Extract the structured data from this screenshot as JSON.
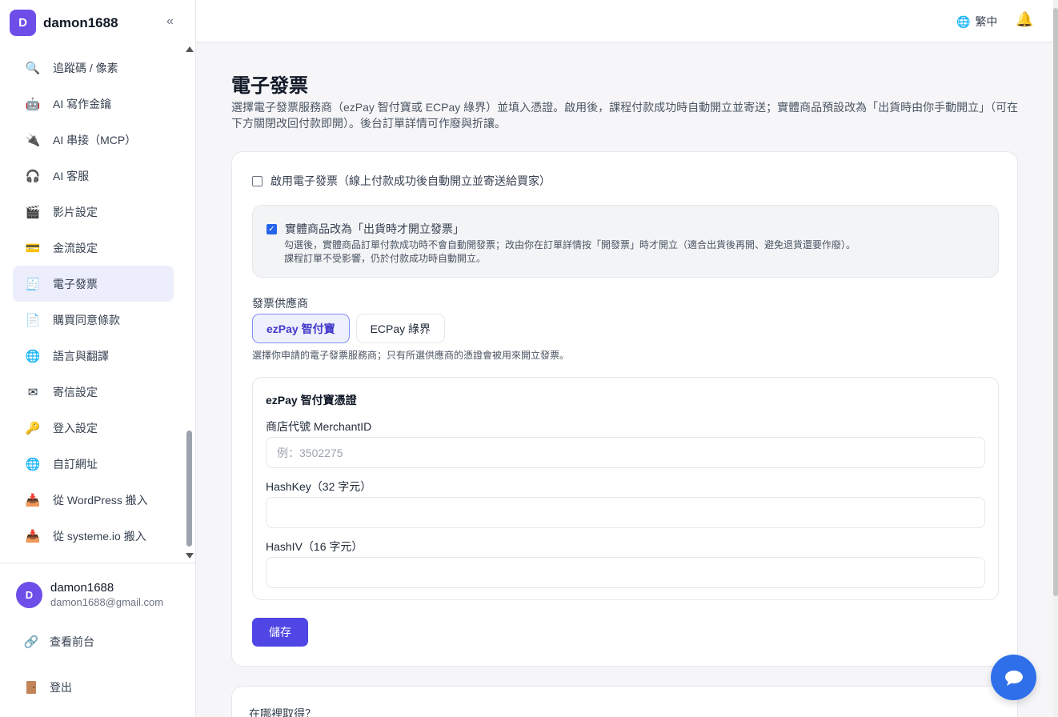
{
  "brand": {
    "initial": "D",
    "name": "damon1688",
    "collapse_icon": "«"
  },
  "sidebar": {
    "items": [
      {
        "label": "追蹤碼 / 像素",
        "icon": "🔍"
      },
      {
        "label": "AI 寫作金鑰",
        "icon": "🤖"
      },
      {
        "label": "AI 串接（MCP）",
        "icon": "🔌"
      },
      {
        "label": "AI 客服",
        "icon": "🎧"
      },
      {
        "label": "影片設定",
        "icon": "🎬"
      },
      {
        "label": "金流設定",
        "icon": "💳"
      },
      {
        "label": "電子發票",
        "icon": "🧾"
      },
      {
        "label": "購買同意條款",
        "icon": "📄"
      },
      {
        "label": "語言與翻譯",
        "icon": "🌐"
      },
      {
        "label": "寄信設定",
        "icon": "✉"
      },
      {
        "label": "登入設定",
        "icon": "🔑"
      },
      {
        "label": "自訂網址",
        "icon": "🌐"
      },
      {
        "label": "從 WordPress 搬入",
        "icon": "📥"
      },
      {
        "label": "從 systeme.io 搬入",
        "icon": "📥"
      }
    ],
    "active_index": 6
  },
  "user": {
    "initial": "D",
    "name": "damon1688",
    "email": "damon1688@gmail.com"
  },
  "side_links": {
    "view_frontend": "查看前台",
    "logout": "登出"
  },
  "topbar": {
    "lang_label": "繁中"
  },
  "main": {
    "title": "電子發票",
    "description": "選擇電子發票服務商（ezPay 智付寶或 ECPay 綠界）並填入憑證。啟用後，課程付款成功時自動開立並寄送；實體商品預設改為「出貨時由你手動開立」（可在下方關閉改回付款即開）。後台訂單詳情可作廢與折讓。",
    "enable_label": "啟用電子發票（線上付款成功後自動開立並寄送給買家）",
    "enable_checked": false,
    "physical_label": "實體商品改為「出貨時才開立發票」",
    "physical_checked": true,
    "physical_hint_1": "勾選後，實體商品訂單付款成功時不會自動開發票；改由你在訂單詳情按「開發票」時才開立（適合出貨後再開、避免退貨還要作廢）。",
    "physical_hint_2": "課程訂單不受影響，仍於付款成功時自動開立。",
    "provider_label": "發票供應商",
    "providers": [
      "ezPay 智付寶",
      "ECPay 綠界"
    ],
    "provider_selected": "ezPay 智付寶",
    "provider_hint": "選擇你申請的電子發票服務商；只有所選供應商的憑證會被用來開立發票。",
    "cred_title": "ezPay 智付寶憑證",
    "merchant_label": "商店代號 MerchantID",
    "merchant_placeholder": "例：3502275",
    "hashkey_label": "HashKey（32 字元）",
    "hashkey_value": "",
    "hashiv_label": "HashIV（16 字元）",
    "hashiv_value": "",
    "save_label": "儲存",
    "where_title": "在哪裡取得？"
  },
  "colors": {
    "accent": "#4f46e5",
    "brand": "#6d4ee8",
    "active_nav": "#eceefc",
    "chat": "#2f6fea"
  }
}
